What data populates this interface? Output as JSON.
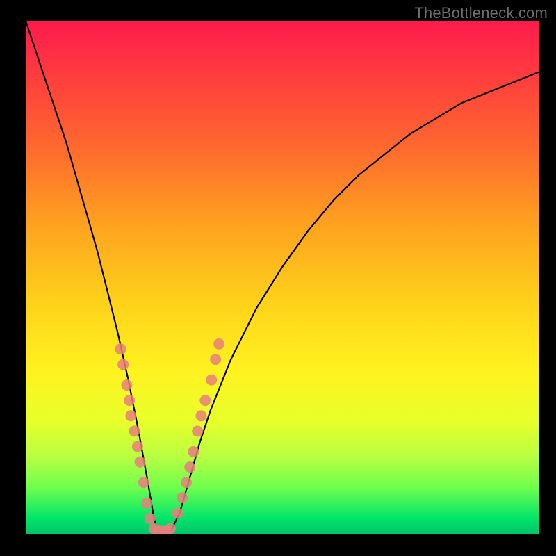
{
  "watermark": {
    "text": "TheBottleneck.com"
  },
  "chart_data": {
    "type": "line",
    "title": "",
    "xlabel": "",
    "ylabel": "",
    "xlim": [
      0,
      100
    ],
    "ylim": [
      0,
      100
    ],
    "series": [
      {
        "name": "bottleneck-curve",
        "x": [
          0,
          2,
          4,
          6,
          8,
          10,
          12,
          14,
          16,
          18,
          20,
          22,
          24,
          25,
          26,
          27,
          28,
          30,
          32,
          34,
          36,
          40,
          45,
          50,
          55,
          60,
          65,
          70,
          75,
          80,
          85,
          90,
          95,
          100
        ],
        "y": [
          100,
          94,
          88,
          82,
          76,
          69,
          62,
          55,
          47,
          39,
          30,
          20,
          9,
          3,
          0,
          0,
          0,
          4,
          11,
          18,
          24,
          34,
          44,
          52,
          59,
          65,
          70,
          74,
          78,
          81,
          84,
          86,
          88,
          90
        ]
      }
    ],
    "markers": {
      "name": "highlight-dots",
      "color": "#e77f7c",
      "points": [
        {
          "x": 18.5,
          "y": 36
        },
        {
          "x": 19.0,
          "y": 33
        },
        {
          "x": 19.7,
          "y": 29
        },
        {
          "x": 20.2,
          "y": 26
        },
        {
          "x": 20.5,
          "y": 23
        },
        {
          "x": 21.2,
          "y": 20
        },
        {
          "x": 21.8,
          "y": 17
        },
        {
          "x": 22.3,
          "y": 14
        },
        {
          "x": 23.0,
          "y": 10
        },
        {
          "x": 23.6,
          "y": 6
        },
        {
          "x": 24.2,
          "y": 3
        },
        {
          "x": 25.0,
          "y": 1
        },
        {
          "x": 25.8,
          "y": 0.5
        },
        {
          "x": 26.6,
          "y": 0.5
        },
        {
          "x": 27.4,
          "y": 0.5
        },
        {
          "x": 28.2,
          "y": 1
        },
        {
          "x": 29.6,
          "y": 4
        },
        {
          "x": 30.5,
          "y": 7
        },
        {
          "x": 31.3,
          "y": 10
        },
        {
          "x": 32.0,
          "y": 13
        },
        {
          "x": 32.7,
          "y": 16
        },
        {
          "x": 33.5,
          "y": 20
        },
        {
          "x": 34.2,
          "y": 23
        },
        {
          "x": 35.0,
          "y": 26
        },
        {
          "x": 36.2,
          "y": 30
        },
        {
          "x": 37.0,
          "y": 34
        },
        {
          "x": 37.7,
          "y": 37
        }
      ]
    }
  }
}
